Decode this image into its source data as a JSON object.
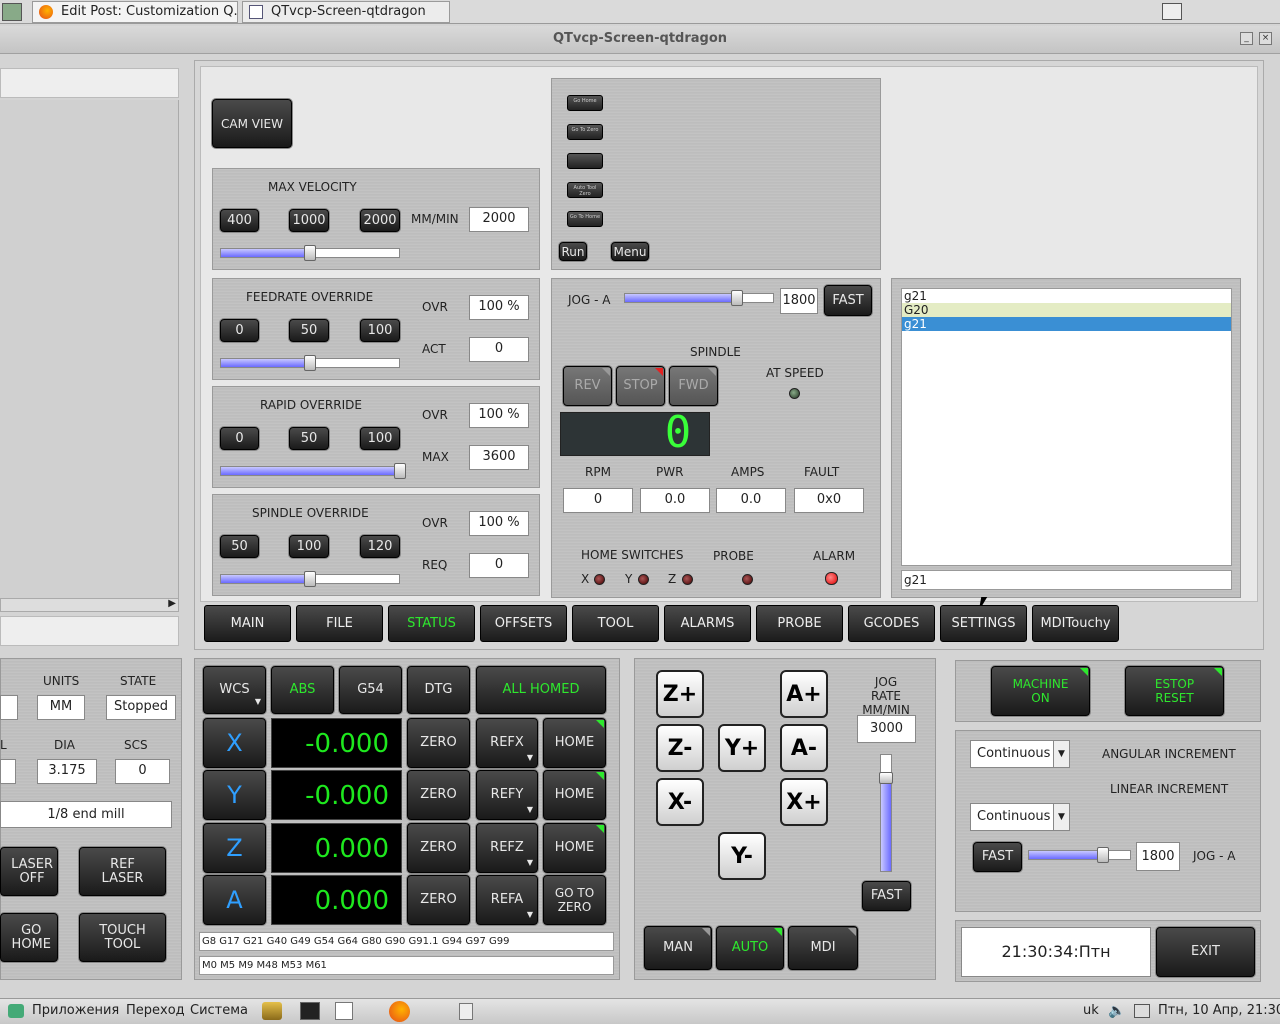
{
  "browser": {
    "tab1": "Edit Post: Customization Q...",
    "tab2": "QTvcp-Screen-qtdragon"
  },
  "window": {
    "title": "QTvcp-Screen-qtdragon"
  },
  "left_strip": {
    "units_label": "UNITS",
    "state_label": "STATE",
    "units_value": "MM",
    "state_value": "Stopped",
    "l_label": "L",
    "dia_label": "DIA",
    "scs_label": "SCS",
    "dia_value": "3.175",
    "scs_value": "0",
    "tool_desc": "1/8 end mill",
    "laser_off": "LASER\nOFF",
    "ref_laser": "REF\nLASER",
    "go_home": "GO\nHOME",
    "touch_tool": "TOUCH\nTOOL"
  },
  "cam_view": "CAM VIEW",
  "max_velocity": {
    "title": "MAX VELOCITY",
    "b1": "400",
    "b2": "1000",
    "b3": "2000",
    "units": "MM/MIN",
    "value": "2000",
    "level": 0.5
  },
  "feedrate": {
    "title": "FEEDRATE OVERRIDE",
    "b1": "0",
    "b2": "50",
    "b3": "100",
    "ovr_label": "OVR",
    "ovr_value": "100 %",
    "act_label": "ACT",
    "act_value": "0",
    "level": 0.5
  },
  "rapid": {
    "title": "RAPID OVERRIDE",
    "b1": "0",
    "b2": "50",
    "b3": "100",
    "ovr_label": "OVR",
    "ovr_value": "100 %",
    "max_label": "MAX",
    "max_value": "3600",
    "level": 1.0
  },
  "spindle_ovr": {
    "title": "SPINDLE OVERRIDE",
    "b1": "50",
    "b2": "100",
    "b3": "120",
    "ovr_label": "OVR",
    "ovr_value": "100 %",
    "req_label": "REQ",
    "req_value": "0",
    "level": 0.5
  },
  "macro": {
    "b1": "Go Home",
    "b2": "Go To Zero",
    "b3": "",
    "b4": "Auto Tool Zero",
    "b5": "Go To Home",
    "run": "Run",
    "menu": "Menu"
  },
  "jog_a": {
    "label": "JOG - A",
    "value": "1800",
    "fast": "FAST",
    "level": 0.75
  },
  "spindle": {
    "title": "SPINDLE",
    "rev": "REV",
    "stop": "STOP",
    "fwd": "FWD",
    "at_speed": "AT SPEED",
    "display": "0",
    "rpm_label": "RPM",
    "pwr_label": "PWR",
    "amps_label": "AMPS",
    "fault_label": "FAULT",
    "rpm": "0",
    "pwr": "0.0",
    "amps": "0.0",
    "fault": "0x0"
  },
  "switches": {
    "home_label": "HOME SWITCHES",
    "x": "X",
    "y": "Y",
    "z": "Z",
    "probe": "PROBE",
    "alarm": "ALARM"
  },
  "mdi": {
    "history": [
      "g21",
      "G20",
      "g21"
    ],
    "input": "g21"
  },
  "tabs": [
    "MAIN",
    "FILE",
    "STATUS",
    "OFFSETS",
    "TOOL",
    "ALARMS",
    "PROBE",
    "GCODES",
    "SETTINGS",
    "MDITouchy"
  ],
  "dro": {
    "wcs": "WCS",
    "abs": "ABS",
    "g54": "G54",
    "dtg": "DTG",
    "all_homed": "ALL HOMED",
    "axes": [
      {
        "axis": "X",
        "value": "-0.000",
        "zero": "ZERO",
        "ref": "REFX",
        "home": "HOME"
      },
      {
        "axis": "Y",
        "value": "-0.000",
        "zero": "ZERO",
        "ref": "REFY",
        "home": "HOME"
      },
      {
        "axis": "Z",
        "value": "0.000",
        "zero": "ZERO",
        "ref": "REFZ",
        "home": "HOME"
      },
      {
        "axis": "A",
        "value": "0.000",
        "zero": "ZERO",
        "ref": "REFA",
        "home": "GO TO\nZERO"
      }
    ],
    "gcodes": "G8 G17 G21 G40 G49 G54 G64 G80 G90 G91.1 G94 G97 G99",
    "mcodes": "M0 M5 M9 M48 M53 M61"
  },
  "jogpad": {
    "zp": "Z+",
    "zm": "Z-",
    "ap": "A+",
    "am": "A-",
    "yp": "Y+",
    "ym": "Y-",
    "xm": "X-",
    "xp": "X+",
    "rate_label": "JOG RATE\nMM/MIN",
    "rate": "3000",
    "fast": "FAST",
    "man": "MAN",
    "auto": "AUTO",
    "mdi": "MDI",
    "level": 0.85
  },
  "machine": {
    "on": "MACHINE\nON",
    "estop": "ESTOP\nRESET"
  },
  "increments": {
    "angular": "Continuous",
    "angular_label": "ANGULAR INCREMENT",
    "linear": "Continuous",
    "linear_label": "LINEAR INCREMENT",
    "fast": "FAST",
    "value": "1800",
    "label": "JOG - A",
    "level": 0.73
  },
  "clock": "21:30:34:Птн",
  "exit": "EXIT",
  "taskbar": {
    "apps": "Приложения",
    "go": "Переход",
    "system": "Система",
    "lang": "uk",
    "datetime": "Птн, 10 Апр, 21:30"
  }
}
